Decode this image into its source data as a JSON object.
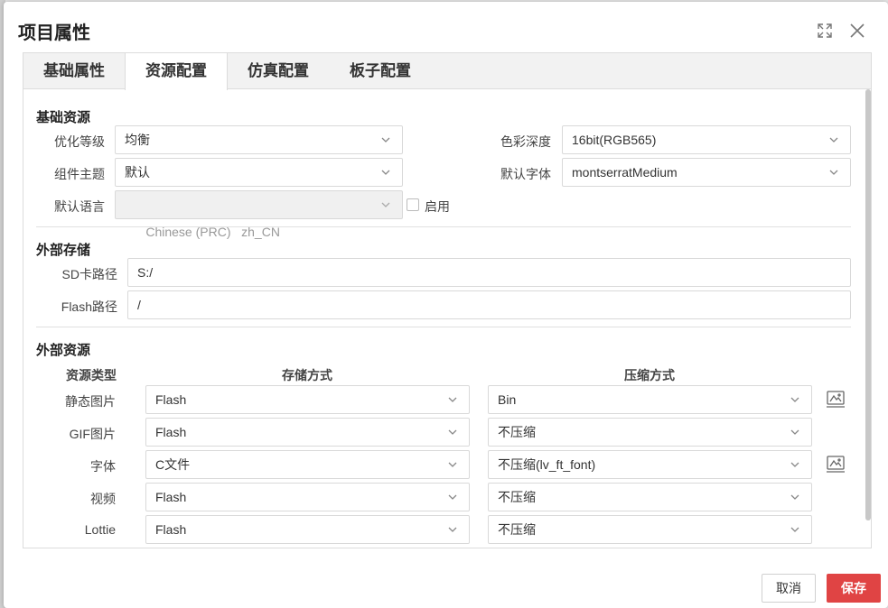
{
  "dialog": {
    "title": "项目属性"
  },
  "tabs": [
    {
      "label": "基础属性"
    },
    {
      "label": "资源配置"
    },
    {
      "label": "仿真配置"
    },
    {
      "label": "板子配置"
    }
  ],
  "basic": {
    "title": "基础资源",
    "opt_label": "优化等级",
    "opt_value": "均衡",
    "theme_label": "组件主题",
    "theme_value": "默认",
    "lang_label": "默认语言",
    "lang_value": "Chinese (PRC)   zh_CN",
    "enable_label": "启用",
    "color_label": "色彩深度",
    "color_value": "16bit(RGB565)",
    "font_label": "默认字体",
    "font_value": "montserratMedium"
  },
  "storage": {
    "title": "外部存储",
    "sd_label": "SD卡路径",
    "sd_value": "S:/",
    "flash_label": "Flash路径",
    "flash_value": "/"
  },
  "resources": {
    "title": "外部资源",
    "col_type": "资源类型",
    "col_storage": "存储方式",
    "col_compress": "压缩方式",
    "rows": [
      {
        "type": "静态图片",
        "storage": "Flash",
        "compress": "Bin"
      },
      {
        "type": "GIF图片",
        "storage": "Flash",
        "compress": "不压缩"
      },
      {
        "type": "字体",
        "storage": "C文件",
        "compress": "不压缩(lv_ft_font)"
      },
      {
        "type": "视频",
        "storage": "Flash",
        "compress": "不压缩"
      },
      {
        "type": "Lottie",
        "storage": "Flash",
        "compress": "不压缩"
      }
    ]
  },
  "footer": {
    "cancel": "取消",
    "save": "保存"
  }
}
